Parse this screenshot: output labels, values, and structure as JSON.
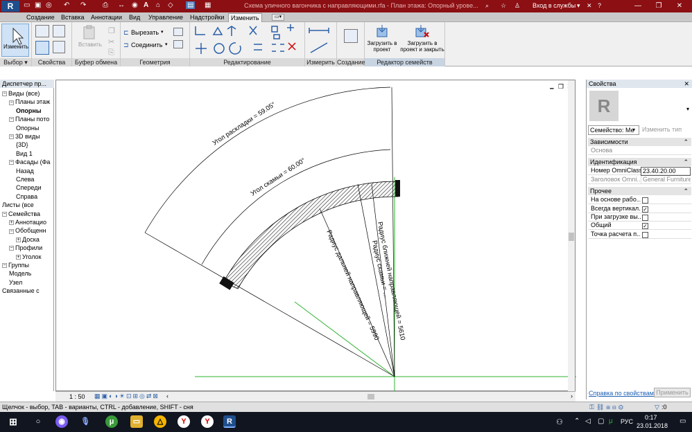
{
  "app": {
    "logo": "R",
    "title": "Схема уличного вагончика с направляющими.rfa - План этажа: Опорный урове...",
    "login": "Вход в службы",
    "minimize": "—",
    "restore": "❐",
    "close": "✕"
  },
  "tabs": [
    "Создание",
    "Вставка",
    "Аннотации",
    "Вид",
    "Управление",
    "Надстройки",
    "Изменить"
  ],
  "active_tab": "Изменить",
  "ribbon": {
    "select": {
      "button": "Изменить",
      "label": "Выбор ▾"
    },
    "properties": {
      "label": "Свойства"
    },
    "clipboard": {
      "paste": "Вставить",
      "label": "Буфер обмена"
    },
    "geometry": {
      "cut": "Вырезать",
      "join": "Соединить",
      "label": "Геометрия"
    },
    "modify": {
      "label": "Редактирование"
    },
    "measure": {
      "label": "Измерить"
    },
    "create": {
      "label": "Создание"
    },
    "family_editor": {
      "load": "Загрузить в проект",
      "load_close": "Загрузить в проект и закрыть",
      "label": "Редактор семейств"
    }
  },
  "browser": {
    "title": "Диспетчер пр...",
    "items": [
      {
        "label": "Виды (все)",
        "indent": 0,
        "exp": "−"
      },
      {
        "label": "Планы этаж",
        "indent": 1,
        "exp": "−"
      },
      {
        "label": "Опорны",
        "indent": 2,
        "exp": "",
        "bold": true
      },
      {
        "label": "Планы пото",
        "indent": 1,
        "exp": "−"
      },
      {
        "label": "Опорны",
        "indent": 2,
        "exp": ""
      },
      {
        "label": "3D виды",
        "indent": 1,
        "exp": "−"
      },
      {
        "label": "{3D}",
        "indent": 2,
        "exp": ""
      },
      {
        "label": "Вид 1",
        "indent": 2,
        "exp": ""
      },
      {
        "label": "Фасады (Фа",
        "indent": 1,
        "exp": "−"
      },
      {
        "label": "Назад",
        "indent": 2,
        "exp": ""
      },
      {
        "label": "Слева",
        "indent": 2,
        "exp": ""
      },
      {
        "label": "Спереди",
        "indent": 2,
        "exp": ""
      },
      {
        "label": "Справа",
        "indent": 2,
        "exp": ""
      },
      {
        "label": "Листы (все",
        "indent": 0,
        "exp": ""
      },
      {
        "label": "Семейства",
        "indent": 0,
        "exp": "−"
      },
      {
        "label": "Аннотацио",
        "indent": 1,
        "exp": "+"
      },
      {
        "label": "Обобщенн",
        "indent": 1,
        "exp": "−"
      },
      {
        "label": "Доска",
        "indent": 2,
        "exp": "+"
      },
      {
        "label": "Профили",
        "indent": 1,
        "exp": "−"
      },
      {
        "label": "Уголок",
        "indent": 2,
        "exp": "+"
      },
      {
        "label": "Группы",
        "indent": 0,
        "exp": "−"
      },
      {
        "label": "Модель",
        "indent": 1,
        "exp": ""
      },
      {
        "label": "Узел",
        "indent": 1,
        "exp": ""
      },
      {
        "label": "Связанные с",
        "indent": 0,
        "exp": ""
      }
    ]
  },
  "drawing": {
    "dim_layout_angle": "Угол раскладки = 59.05°",
    "dim_bench_angle": "Угол скамьи = 60.00°",
    "dim_far_radius": "Радиус дальней направляющей = 5990",
    "dim_near_radius": "Радиус ближней направляющей = 5610",
    "dim_bench_radius": "Радиус скамьи = ..."
  },
  "viewbar": {
    "scale": "1 : 50"
  },
  "properties": {
    "title": "Свойства",
    "type_selector": "Семейство: Ме",
    "edit_type": "Изменить тип",
    "sections": [
      {
        "name": "Зависимости",
        "rows": [
          {
            "label": "Основа",
            "value": "",
            "grey": true
          }
        ]
      },
      {
        "name": "Идентификация",
        "rows": [
          {
            "label": "Номер OmniClass",
            "value": "23.40.20.00"
          },
          {
            "label": "Заголовок Omni...",
            "value": "General Furniture ...",
            "grey": true
          }
        ]
      },
      {
        "name": "Прочее",
        "rows": [
          {
            "label": "На основе рабо...",
            "check": false
          },
          {
            "label": "Всегда вертикал...",
            "check": true
          },
          {
            "label": "При загрузке вы...",
            "check": false
          },
          {
            "label": "Общий",
            "check": true
          },
          {
            "label": "Точка расчета п...",
            "check": false
          }
        ]
      }
    ],
    "help_link": "Справка по свойствам",
    "apply": "Применить"
  },
  "status": {
    "text": "Щелчок - выбор, TAB - варианты, CTRL - добавление, SHIFT - сня",
    "filter_count": ":0"
  },
  "taskbar": {
    "lang": "РУС",
    "time": "0:17",
    "date": "23.01.2018"
  },
  "colors": {
    "title_bg": "#8b0f13",
    "taskbar_bg": "#101520",
    "green_line": "#2db32d"
  }
}
